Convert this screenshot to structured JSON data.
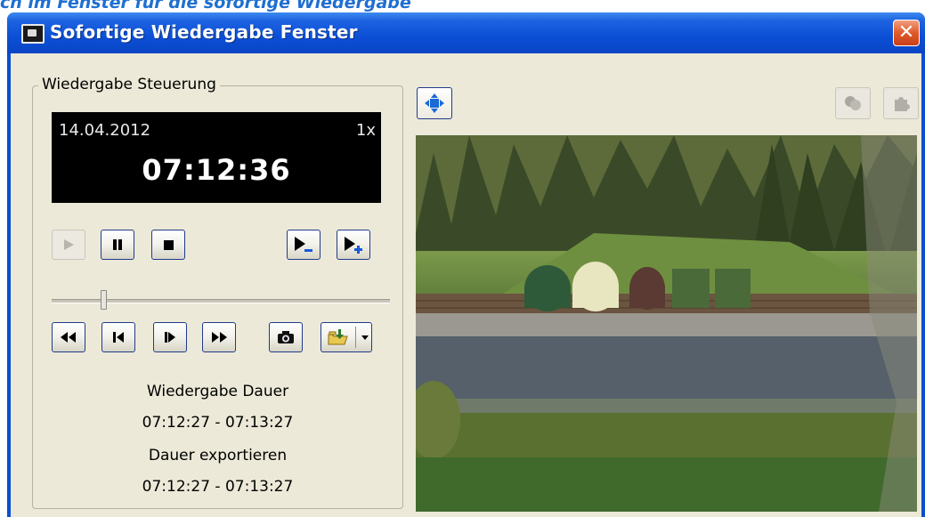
{
  "page": {
    "caption": "ch im Fenster für die sofortige Wiedergabe"
  },
  "window": {
    "title": "Sofortige Wiedergabe Fenster"
  },
  "playback": {
    "group_label": "Wiedergabe Steuerung",
    "date": "14.04.2012",
    "speed": "1x",
    "time": "07:12:36",
    "position_fraction": 0.15,
    "duration_label": "Wiedergabe Dauer",
    "duration_range": "07:12:27 - 07:13:27",
    "export_label": "Dauer exportieren",
    "export_range": "07:12:27  - 07:13:27"
  },
  "icons": {
    "play": "play-icon",
    "pause": "pause-icon",
    "stop": "stop-icon",
    "slower": "play-slower-icon",
    "faster": "play-faster-icon",
    "rewind": "rewind-icon",
    "step_back": "step-back-icon",
    "step_forward": "step-forward-icon",
    "fast_forward": "fast-forward-icon",
    "snapshot": "camera-icon",
    "export": "export-folder-icon",
    "fit": "fit-window-icon"
  },
  "colors": {
    "title_bar": "#0a4fd0",
    "close": "#e05a2a",
    "caption": "#1f6fd0",
    "display_bg": "#000000"
  }
}
